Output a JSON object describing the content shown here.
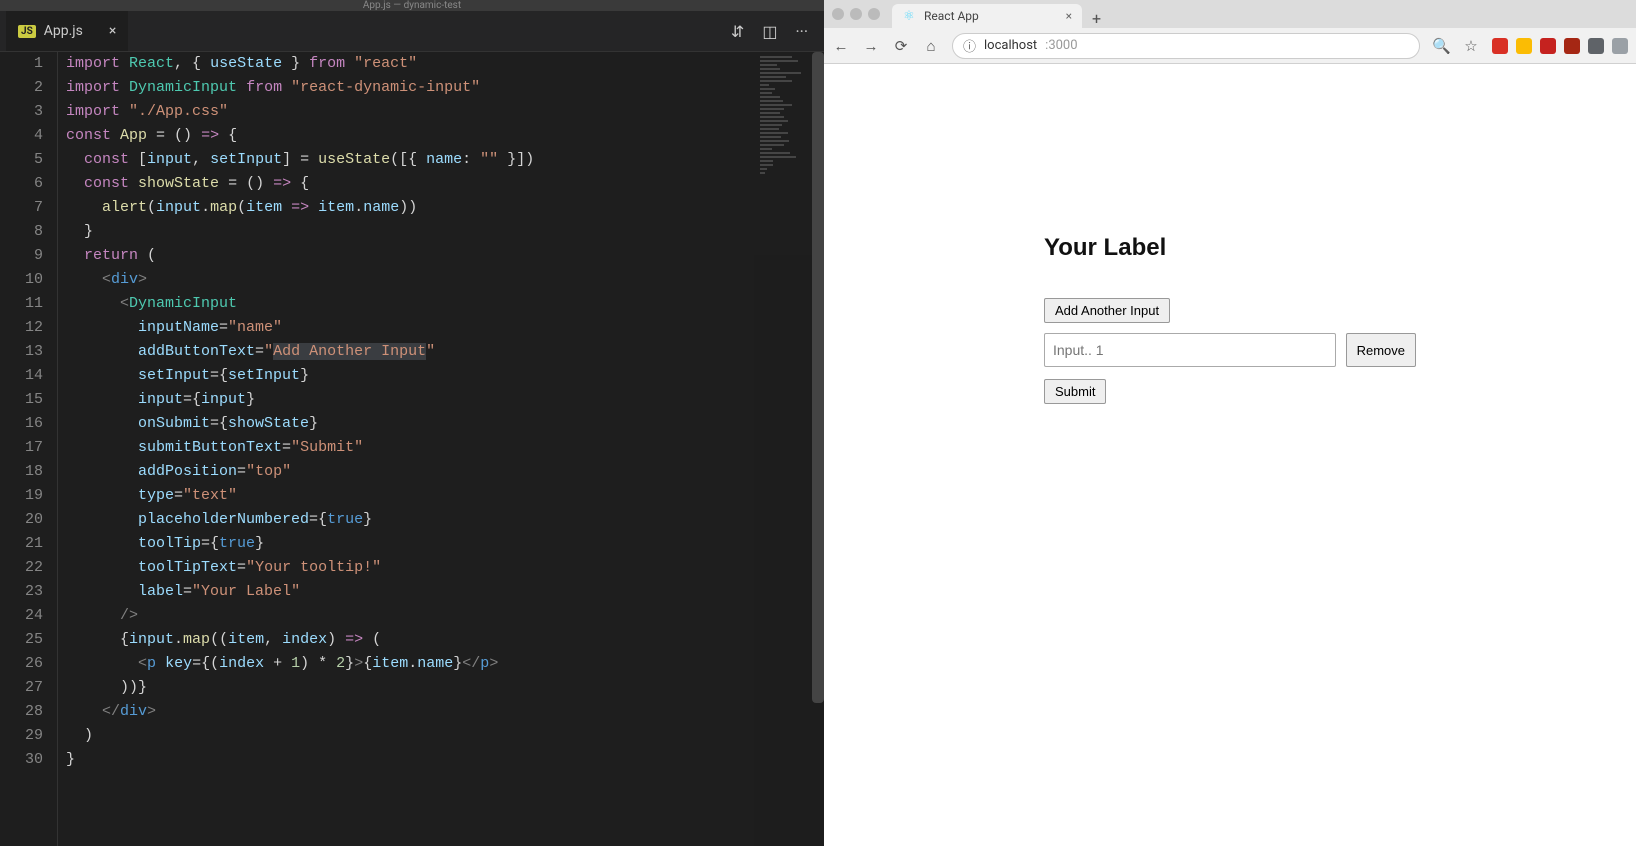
{
  "vscode": {
    "window_title": "App.js — dynamic-test",
    "tab": {
      "badge": "JS",
      "filename": "App.js"
    },
    "lines": [
      [
        {
          "c": "tk-kw",
          "t": "import"
        },
        {
          "c": "",
          "t": " "
        },
        {
          "c": "tk-type",
          "t": "React"
        },
        {
          "c": "",
          "t": ", { "
        },
        {
          "c": "tk-var",
          "t": "useState"
        },
        {
          "c": "",
          "t": " } "
        },
        {
          "c": "tk-kw",
          "t": "from"
        },
        {
          "c": "",
          "t": " "
        },
        {
          "c": "tk-str",
          "t": "\"react\""
        }
      ],
      [
        {
          "c": "tk-kw",
          "t": "import"
        },
        {
          "c": "",
          "t": " "
        },
        {
          "c": "tk-type",
          "t": "DynamicInput"
        },
        {
          "c": "",
          "t": " "
        },
        {
          "c": "tk-kw",
          "t": "from"
        },
        {
          "c": "",
          "t": " "
        },
        {
          "c": "tk-str",
          "t": "\"react-dynamic-input\""
        }
      ],
      [
        {
          "c": "tk-kw",
          "t": "import"
        },
        {
          "c": "",
          "t": " "
        },
        {
          "c": "tk-str",
          "t": "\"./App.css\""
        }
      ],
      [
        {
          "c": "tk-kw",
          "t": "const"
        },
        {
          "c": "",
          "t": " "
        },
        {
          "c": "tk-fn",
          "t": "App"
        },
        {
          "c": "",
          "t": " = () "
        },
        {
          "c": "tk-kw",
          "t": "=>"
        },
        {
          "c": "",
          "t": " {"
        }
      ],
      [
        {
          "c": "",
          "t": "  "
        },
        {
          "c": "tk-kw",
          "t": "const"
        },
        {
          "c": "",
          "t": " ["
        },
        {
          "c": "tk-var",
          "t": "input"
        },
        {
          "c": "",
          "t": ", "
        },
        {
          "c": "tk-var",
          "t": "setInput"
        },
        {
          "c": "",
          "t": "] = "
        },
        {
          "c": "tk-fn",
          "t": "useState"
        },
        {
          "c": "",
          "t": "([{ "
        },
        {
          "c": "tk-var",
          "t": "name"
        },
        {
          "c": "",
          "t": ": "
        },
        {
          "c": "tk-str",
          "t": "\"\""
        },
        {
          "c": "",
          "t": " }])"
        }
      ],
      [
        {
          "c": "",
          "t": "  "
        },
        {
          "c": "tk-kw",
          "t": "const"
        },
        {
          "c": "",
          "t": " "
        },
        {
          "c": "tk-fn",
          "t": "showState"
        },
        {
          "c": "",
          "t": " = () "
        },
        {
          "c": "tk-kw",
          "t": "=>"
        },
        {
          "c": "",
          "t": " {"
        }
      ],
      [
        {
          "c": "",
          "t": "    "
        },
        {
          "c": "tk-fn",
          "t": "alert"
        },
        {
          "c": "",
          "t": "("
        },
        {
          "c": "tk-var",
          "t": "input"
        },
        {
          "c": "",
          "t": "."
        },
        {
          "c": "tk-fn",
          "t": "map"
        },
        {
          "c": "",
          "t": "("
        },
        {
          "c": "tk-var",
          "t": "item"
        },
        {
          "c": "",
          "t": " "
        },
        {
          "c": "tk-kw",
          "t": "=>"
        },
        {
          "c": "",
          "t": " "
        },
        {
          "c": "tk-var",
          "t": "item"
        },
        {
          "c": "",
          "t": "."
        },
        {
          "c": "tk-var",
          "t": "name"
        },
        {
          "c": "",
          "t": "))"
        }
      ],
      [
        {
          "c": "",
          "t": "  }"
        }
      ],
      [
        {
          "c": "",
          "t": "  "
        },
        {
          "c": "tk-kw",
          "t": "return"
        },
        {
          "c": "",
          "t": " ("
        }
      ],
      [
        {
          "c": "",
          "t": "    "
        },
        {
          "c": "tk-pun",
          "t": "<"
        },
        {
          "c": "tk-bool",
          "t": "div"
        },
        {
          "c": "tk-pun",
          "t": ">"
        }
      ],
      [
        {
          "c": "",
          "t": "      "
        },
        {
          "c": "tk-pun",
          "t": "<"
        },
        {
          "c": "tk-tag",
          "t": "DynamicInput"
        }
      ],
      [
        {
          "c": "",
          "t": "        "
        },
        {
          "c": "tk-attr",
          "t": "inputName"
        },
        {
          "c": "",
          "t": "="
        },
        {
          "c": "tk-str",
          "t": "\"name\""
        }
      ],
      [
        {
          "c": "",
          "t": "        "
        },
        {
          "c": "tk-attr",
          "t": "addButtonText"
        },
        {
          "c": "",
          "t": "="
        },
        {
          "c": "tk-str",
          "t": "\""
        },
        {
          "c": "tk-str hl-sel",
          "t": "Add Another Input"
        },
        {
          "c": "tk-str",
          "t": "\""
        }
      ],
      [
        {
          "c": "",
          "t": "        "
        },
        {
          "c": "tk-attr",
          "t": "setInput"
        },
        {
          "c": "",
          "t": "={"
        },
        {
          "c": "tk-var",
          "t": "setInput"
        },
        {
          "c": "",
          "t": "}"
        }
      ],
      [
        {
          "c": "",
          "t": "        "
        },
        {
          "c": "tk-attr",
          "t": "input"
        },
        {
          "c": "",
          "t": "={"
        },
        {
          "c": "tk-var",
          "t": "input"
        },
        {
          "c": "",
          "t": "}"
        }
      ],
      [
        {
          "c": "",
          "t": "        "
        },
        {
          "c": "tk-attr",
          "t": "onSubmit"
        },
        {
          "c": "",
          "t": "={"
        },
        {
          "c": "tk-var",
          "t": "showState"
        },
        {
          "c": "",
          "t": "}"
        }
      ],
      [
        {
          "c": "",
          "t": "        "
        },
        {
          "c": "tk-attr",
          "t": "submitButtonText"
        },
        {
          "c": "",
          "t": "="
        },
        {
          "c": "tk-str",
          "t": "\"Submit\""
        }
      ],
      [
        {
          "c": "",
          "t": "        "
        },
        {
          "c": "tk-attr",
          "t": "addPosition"
        },
        {
          "c": "",
          "t": "="
        },
        {
          "c": "tk-str",
          "t": "\"top\""
        }
      ],
      [
        {
          "c": "",
          "t": "        "
        },
        {
          "c": "tk-attr",
          "t": "type"
        },
        {
          "c": "",
          "t": "="
        },
        {
          "c": "tk-str",
          "t": "\"text\""
        }
      ],
      [
        {
          "c": "",
          "t": "        "
        },
        {
          "c": "tk-attr",
          "t": "placeholderNumbered"
        },
        {
          "c": "",
          "t": "={"
        },
        {
          "c": "tk-bool",
          "t": "true"
        },
        {
          "c": "",
          "t": "}"
        }
      ],
      [
        {
          "c": "",
          "t": "        "
        },
        {
          "c": "tk-attr",
          "t": "toolTip"
        },
        {
          "c": "",
          "t": "={"
        },
        {
          "c": "tk-bool",
          "t": "true"
        },
        {
          "c": "",
          "t": "}"
        }
      ],
      [
        {
          "c": "",
          "t": "        "
        },
        {
          "c": "tk-attr",
          "t": "toolTipText"
        },
        {
          "c": "",
          "t": "="
        },
        {
          "c": "tk-str",
          "t": "\"Your tooltip!\""
        }
      ],
      [
        {
          "c": "",
          "t": "        "
        },
        {
          "c": "tk-attr",
          "t": "label"
        },
        {
          "c": "",
          "t": "="
        },
        {
          "c": "tk-str",
          "t": "\"Your Label\""
        }
      ],
      [
        {
          "c": "",
          "t": "      "
        },
        {
          "c": "tk-pun",
          "t": "/>"
        }
      ],
      [
        {
          "c": "",
          "t": "      {"
        },
        {
          "c": "tk-var",
          "t": "input"
        },
        {
          "c": "",
          "t": "."
        },
        {
          "c": "tk-fn",
          "t": "map"
        },
        {
          "c": "",
          "t": "(("
        },
        {
          "c": "tk-var",
          "t": "item"
        },
        {
          "c": "",
          "t": ", "
        },
        {
          "c": "tk-var",
          "t": "index"
        },
        {
          "c": "",
          "t": ") "
        },
        {
          "c": "tk-kw",
          "t": "=>"
        },
        {
          "c": "",
          "t": " ("
        }
      ],
      [
        {
          "c": "",
          "t": "        "
        },
        {
          "c": "tk-pun",
          "t": "<"
        },
        {
          "c": "tk-bool",
          "t": "p"
        },
        {
          "c": "",
          "t": " "
        },
        {
          "c": "tk-attr",
          "t": "key"
        },
        {
          "c": "",
          "t": "={("
        },
        {
          "c": "tk-var",
          "t": "index"
        },
        {
          "c": "",
          "t": " + "
        },
        {
          "c": "tk-num",
          "t": "1"
        },
        {
          "c": "",
          "t": ") * "
        },
        {
          "c": "tk-num",
          "t": "2"
        },
        {
          "c": "",
          "t": "}"
        },
        {
          "c": "tk-pun",
          "t": ">"
        },
        {
          "c": "",
          "t": "{"
        },
        {
          "c": "tk-var",
          "t": "item"
        },
        {
          "c": "",
          "t": "."
        },
        {
          "c": "tk-var",
          "t": "name"
        },
        {
          "c": "",
          "t": "}"
        },
        {
          "c": "tk-pun",
          "t": "</"
        },
        {
          "c": "tk-bool",
          "t": "p"
        },
        {
          "c": "tk-pun",
          "t": ">"
        }
      ],
      [
        {
          "c": "",
          "t": "      ))}"
        }
      ],
      [
        {
          "c": "",
          "t": "    "
        },
        {
          "c": "tk-pun",
          "t": "</"
        },
        {
          "c": "tk-bool",
          "t": "div"
        },
        {
          "c": "tk-pun",
          "t": ">"
        }
      ],
      [
        {
          "c": "",
          "t": "  )"
        }
      ],
      [
        {
          "c": "",
          "t": "}"
        }
      ]
    ]
  },
  "browser": {
    "tab_title": "React App",
    "url_host": "localhost",
    "url_path": ":3000",
    "page": {
      "label_heading": "Your Label",
      "add_button": "Add Another Input",
      "input_placeholder": "Input.. 1",
      "remove_button": "Remove",
      "submit_button": "Submit"
    }
  }
}
